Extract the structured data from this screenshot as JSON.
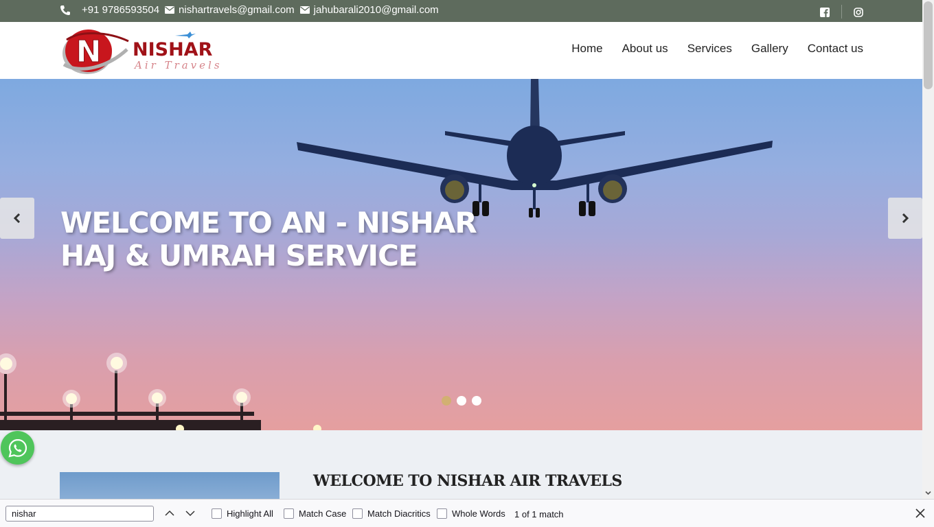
{
  "topbar": {
    "phone": "+91 9786593504",
    "email1": "nishartravels@gmail.com",
    "email2": "jahubarali2010@gmail.com",
    "icons": [
      "phone-icon",
      "envelope-icon",
      "facebook-icon",
      "instagram-icon"
    ]
  },
  "logo": {
    "name": "NISHAR",
    "tagline": "Air Travels",
    "letter": "N"
  },
  "nav": {
    "items": [
      {
        "label": "Home"
      },
      {
        "label": "About us"
      },
      {
        "label": "Services"
      },
      {
        "label": "Gallery"
      },
      {
        "label": "Contact us"
      }
    ]
  },
  "hero": {
    "heading_line1": "WELCOME TO AN - NISHAR",
    "heading_line2": "HAJ & UMRAH SERVICE",
    "slides_count": 3,
    "active_slide": 1
  },
  "welcome": {
    "title": "WELCOME TO NISHAR AIR TRAVELS"
  },
  "findbar": {
    "query": "nishar",
    "highlight_all": "Highlight All",
    "match_case": "Match Case",
    "match_diacritics": "Match Diacritics",
    "whole_words": "Whole Words",
    "status": "1 of 1 match"
  },
  "colors": {
    "topbar_bg": "#5e6b5d",
    "active_dot": "#d2b072",
    "whatsapp": "#4fc55b",
    "logo_red": "#c8161d"
  }
}
